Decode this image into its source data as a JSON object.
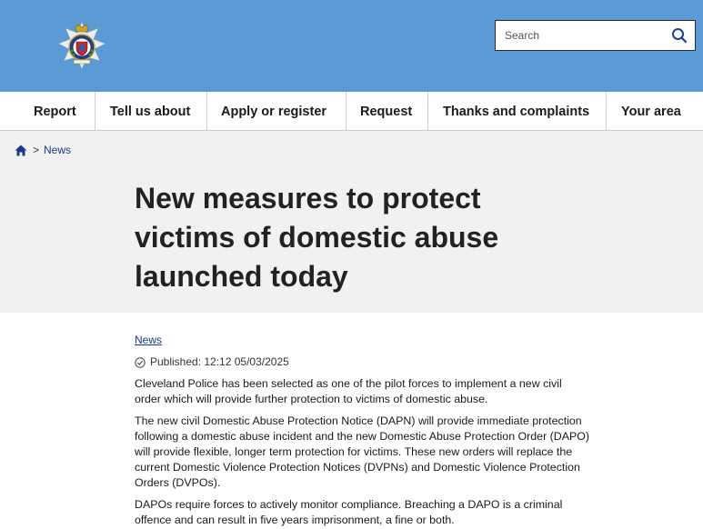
{
  "header": {
    "search_placeholder": "Search"
  },
  "nav": {
    "items": [
      {
        "label": "Report"
      },
      {
        "label": "Tell us about"
      },
      {
        "label": "Apply or register"
      },
      {
        "label": "Request"
      },
      {
        "label": "Thanks and complaints"
      },
      {
        "label": "Your area"
      }
    ]
  },
  "breadcrumb": {
    "separator": ">",
    "current": "News"
  },
  "article": {
    "title": "New measures to protect victims of domestic abuse launched today",
    "category": "News",
    "published": "Published:  12:12  05/03/2025",
    "paragraphs": [
      "Cleveland Police has been selected as one of the pilot forces to implement a new civil order which will provide further protection to victims of domestic abuse.",
      "The new civil Domestic Abuse Protection Notice (DAPN) will provide immediate protection following a domestic abuse incident and the new Domestic Abuse Protection Order (DAPO) will provide flexible, longer term protection for victims.  These new orders will replace the current Domestic Violence Protection Notices (DVPNs) and Domestic Violence Protection Orders (DVPOs).",
      "DAPOs require forces to actively monitor compliance.  Breaching a DAPO is a criminal offence and can result in five years imprisonment, a fine or both."
    ]
  },
  "colors": {
    "header_blue": "#5b9bd5",
    "hero_grey": "#f1f1f1",
    "link_blue": "#1d3a8a"
  },
  "icons": {
    "logo": "police-crest-icon",
    "search": "search-icon",
    "home": "home-icon",
    "published": "check-circle-icon"
  }
}
